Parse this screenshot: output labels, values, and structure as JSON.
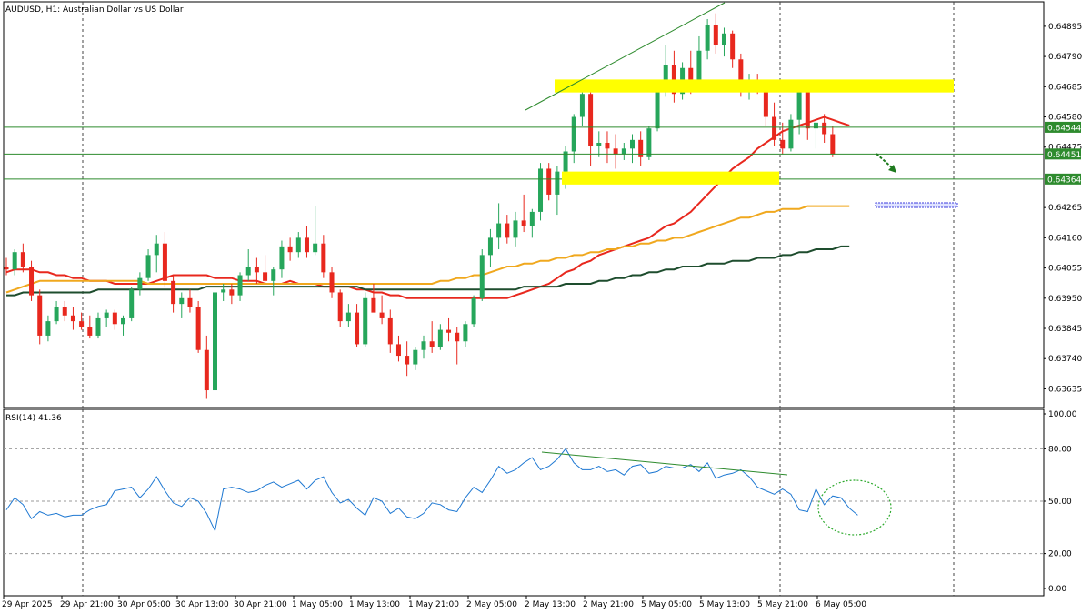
{
  "chart_data": {
    "type": "candlestick",
    "symbol": "AUDUSD",
    "timeframe": "H1",
    "title": "AUDUSD, H1:  Australian Dollar vs US Dollar",
    "price_axis_ticks": [
      "0.64895",
      "0.64790",
      "0.64685",
      "0.64580",
      "0.64475",
      "0.64265",
      "0.64160",
      "0.64055",
      "0.63950",
      "0.63845",
      "0.63740",
      "0.63635"
    ],
    "price_range": [
      0.6357,
      0.6498
    ],
    "time_labels": [
      "29 Apr 2025",
      "29 Apr 21:00",
      "30 Apr 05:00",
      "30 Apr 13:00",
      "30 Apr 21:00",
      "1 May 05:00",
      "1 May 13:00",
      "1 May 21:00",
      "2 May 05:00",
      "2 May 13:00",
      "2 May 21:00",
      "5 May 05:00",
      "5 May 13:00",
      "5 May 21:00",
      "6 May 05:00"
    ],
    "horizontal_levels": [
      {
        "value": 0.64544,
        "label": "0.64544",
        "color": "#2e8b2e"
      },
      {
        "value": 0.64451,
        "label": "0.64451",
        "color": "#2e8b2e"
      },
      {
        "value": 0.64364,
        "label": "0.64364",
        "color": "#2e8b2e"
      }
    ],
    "moving_averages": [
      {
        "color": "#e8281e",
        "values_from_hour": 0,
        "values": [
          0.6404,
          0.6405,
          0.6405,
          0.6405,
          0.6404,
          0.6404,
          0.6403,
          0.6403,
          0.6402,
          0.6402,
          0.6401,
          0.6401,
          0.6401,
          0.64,
          0.64,
          0.64,
          0.64,
          0.64,
          0.6401,
          0.6402,
          0.6403,
          0.6403,
          0.6403,
          0.6403,
          0.6403,
          0.6402,
          0.6402,
          0.6402,
          0.6401,
          0.6401,
          0.6401,
          0.64,
          0.64,
          0.64,
          0.6401,
          0.64,
          0.64,
          0.64,
          0.6399,
          0.6399,
          0.6399,
          0.6399,
          0.6398,
          0.6398,
          0.6397,
          0.6397,
          0.6396,
          0.6396,
          0.6395,
          0.6395,
          0.6395,
          0.6395,
          0.6395,
          0.6395,
          0.6395,
          0.6395,
          0.6395,
          0.6395,
          0.6395,
          0.6395,
          0.6395,
          0.6396,
          0.6397,
          0.6398,
          0.6399,
          0.64,
          0.6402,
          0.6404,
          0.6405,
          0.6407,
          0.6408,
          0.641,
          0.6411,
          0.6412,
          0.6413,
          0.6414,
          0.6415,
          0.6416,
          0.6418,
          0.642,
          0.6421,
          0.6423,
          0.6425,
          0.6428,
          0.6431,
          0.6434,
          0.6437,
          0.644,
          0.6442,
          0.6444,
          0.6447,
          0.6449,
          0.6451,
          0.6453,
          0.6454,
          0.6455,
          0.6456,
          0.6457,
          0.6458,
          0.6457,
          0.6456,
          0.6455
        ]
      },
      {
        "color": "#f0a81e",
        "values_from_hour": 0,
        "values": [
          0.6397,
          0.6398,
          0.6399,
          0.64,
          0.6401,
          0.6401,
          0.6401,
          0.6401,
          0.6401,
          0.6401,
          0.6401,
          0.6401,
          0.6401,
          0.6401,
          0.6401,
          0.6401,
          0.6401,
          0.64,
          0.64,
          0.64,
          0.64,
          0.64,
          0.64,
          0.64,
          0.64,
          0.64,
          0.64,
          0.64,
          0.64,
          0.64,
          0.64,
          0.64,
          0.64,
          0.64,
          0.64,
          0.64,
          0.64,
          0.64,
          0.64,
          0.64,
          0.64,
          0.64,
          0.64,
          0.64,
          0.64,
          0.64,
          0.64,
          0.64,
          0.64,
          0.64,
          0.64,
          0.64,
          0.6401,
          0.6401,
          0.6402,
          0.6402,
          0.6403,
          0.6403,
          0.6404,
          0.6405,
          0.6406,
          0.6406,
          0.6407,
          0.6407,
          0.6408,
          0.6408,
          0.6409,
          0.6409,
          0.641,
          0.641,
          0.6411,
          0.6411,
          0.6412,
          0.6412,
          0.6413,
          0.6413,
          0.6414,
          0.6414,
          0.6415,
          0.6415,
          0.6416,
          0.6416,
          0.6417,
          0.6418,
          0.6419,
          0.642,
          0.6421,
          0.6422,
          0.6423,
          0.6423,
          0.6424,
          0.6425,
          0.6425,
          0.6426,
          0.6426,
          0.6426,
          0.6427,
          0.6427,
          0.6427,
          0.6427,
          0.6427,
          0.6427
        ]
      },
      {
        "color": "#1e4d2e",
        "values_from_hour": 0,
        "values": [
          0.6396,
          0.6396,
          0.6397,
          0.6397,
          0.6397,
          0.6397,
          0.6397,
          0.6397,
          0.6397,
          0.6397,
          0.6397,
          0.6398,
          0.6398,
          0.6398,
          0.6398,
          0.6398,
          0.6398,
          0.6398,
          0.6398,
          0.6398,
          0.6398,
          0.6398,
          0.6398,
          0.6398,
          0.6399,
          0.6399,
          0.6399,
          0.6399,
          0.6399,
          0.6399,
          0.6399,
          0.6399,
          0.6399,
          0.6399,
          0.6399,
          0.6399,
          0.6399,
          0.6399,
          0.6399,
          0.6399,
          0.6399,
          0.6399,
          0.6399,
          0.6398,
          0.6398,
          0.6398,
          0.6398,
          0.6398,
          0.6398,
          0.6398,
          0.6398,
          0.6398,
          0.6398,
          0.6398,
          0.6398,
          0.6398,
          0.6398,
          0.6398,
          0.6398,
          0.6398,
          0.6398,
          0.6398,
          0.6399,
          0.6399,
          0.6399,
          0.6399,
          0.6399,
          0.64,
          0.64,
          0.64,
          0.64,
          0.6401,
          0.6401,
          0.6402,
          0.6402,
          0.6403,
          0.6403,
          0.6404,
          0.6404,
          0.6405,
          0.6405,
          0.6406,
          0.6406,
          0.6406,
          0.6407,
          0.6407,
          0.6407,
          0.6408,
          0.6408,
          0.6408,
          0.6409,
          0.6409,
          0.6409,
          0.641,
          0.641,
          0.6411,
          0.6411,
          0.6412,
          0.6412,
          0.6412,
          0.6413,
          0.6413
        ]
      }
    ],
    "candles": [
      [
        0.6406,
        0.6409,
        0.6403,
        0.6405
      ],
      [
        0.6405,
        0.6412,
        0.6403,
        0.6411
      ],
      [
        0.6411,
        0.6414,
        0.6404,
        0.6406
      ],
      [
        0.6406,
        0.6408,
        0.6394,
        0.6396
      ],
      [
        0.6396,
        0.6398,
        0.6379,
        0.6382
      ],
      [
        0.6382,
        0.6389,
        0.638,
        0.6387
      ],
      [
        0.6387,
        0.6394,
        0.6386,
        0.6392
      ],
      [
        0.6392,
        0.6394,
        0.6387,
        0.6389
      ],
      [
        0.6389,
        0.6392,
        0.6384,
        0.6387
      ],
      [
        0.6387,
        0.639,
        0.6384,
        0.6385
      ],
      [
        0.6385,
        0.6389,
        0.6381,
        0.6382
      ],
      [
        0.6382,
        0.639,
        0.6381,
        0.6388
      ],
      [
        0.6388,
        0.6391,
        0.6385,
        0.639
      ],
      [
        0.639,
        0.6391,
        0.6384,
        0.6386
      ],
      [
        0.6386,
        0.6389,
        0.6382,
        0.6388
      ],
      [
        0.6388,
        0.6399,
        0.6387,
        0.6398
      ],
      [
        0.6398,
        0.6404,
        0.6396,
        0.6402
      ],
      [
        0.6402,
        0.6412,
        0.6401,
        0.641
      ],
      [
        0.641,
        0.6417,
        0.6404,
        0.6414
      ],
      [
        0.6414,
        0.6418,
        0.6399,
        0.6401
      ],
      [
        0.6401,
        0.6403,
        0.639,
        0.6393
      ],
      [
        0.6393,
        0.6397,
        0.6388,
        0.6395
      ],
      [
        0.6395,
        0.6398,
        0.639,
        0.6392
      ],
      [
        0.6392,
        0.6394,
        0.6376,
        0.6377
      ],
      [
        0.6377,
        0.6382,
        0.636,
        0.6363
      ],
      [
        0.6363,
        0.6399,
        0.6361,
        0.6397
      ],
      [
        0.6397,
        0.64,
        0.6394,
        0.6398
      ],
      [
        0.6398,
        0.64,
        0.6393,
        0.6396
      ],
      [
        0.6396,
        0.6404,
        0.6394,
        0.6403
      ],
      [
        0.6403,
        0.6412,
        0.6401,
        0.6406
      ],
      [
        0.6406,
        0.6409,
        0.64,
        0.6404
      ],
      [
        0.6404,
        0.641,
        0.64,
        0.6401
      ],
      [
        0.6401,
        0.6406,
        0.6396,
        0.6405
      ],
      [
        0.6405,
        0.6415,
        0.6402,
        0.6413
      ],
      [
        0.6413,
        0.6416,
        0.6408,
        0.6411
      ],
      [
        0.6411,
        0.6418,
        0.6409,
        0.6416
      ],
      [
        0.6416,
        0.642,
        0.6409,
        0.6411
      ],
      [
        0.6411,
        0.6427,
        0.641,
        0.6414
      ],
      [
        0.6414,
        0.6417,
        0.6402,
        0.6404
      ],
      [
        0.6404,
        0.6406,
        0.6395,
        0.6397
      ],
      [
        0.6397,
        0.6398,
        0.6385,
        0.6387
      ],
      [
        0.6387,
        0.6393,
        0.6385,
        0.639
      ],
      [
        0.639,
        0.6393,
        0.6378,
        0.6379
      ],
      [
        0.6379,
        0.6397,
        0.6378,
        0.6395
      ],
      [
        0.6395,
        0.64,
        0.6392,
        0.639
      ],
      [
        0.639,
        0.6396,
        0.6386,
        0.6388
      ],
      [
        0.6388,
        0.6391,
        0.6376,
        0.6379
      ],
      [
        0.6379,
        0.6382,
        0.6373,
        0.6375
      ],
      [
        0.6375,
        0.638,
        0.6368,
        0.6372
      ],
      [
        0.6372,
        0.6378,
        0.637,
        0.6377
      ],
      [
        0.6377,
        0.6382,
        0.6374,
        0.638
      ],
      [
        0.638,
        0.6387,
        0.6376,
        0.6378
      ],
      [
        0.6378,
        0.6386,
        0.6377,
        0.6384
      ],
      [
        0.6384,
        0.6388,
        0.638,
        0.6383
      ],
      [
        0.6383,
        0.6385,
        0.6372,
        0.638
      ],
      [
        0.638,
        0.6387,
        0.6378,
        0.6386
      ],
      [
        0.6386,
        0.6396,
        0.6385,
        0.6395
      ],
      [
        0.6395,
        0.6412,
        0.6394,
        0.641
      ],
      [
        0.641,
        0.6419,
        0.6406,
        0.6416
      ],
      [
        0.6416,
        0.6428,
        0.6412,
        0.6421
      ],
      [
        0.6421,
        0.6424,
        0.6414,
        0.6416
      ],
      [
        0.6416,
        0.6425,
        0.6413,
        0.6422
      ],
      [
        0.6422,
        0.6431,
        0.6418,
        0.642
      ],
      [
        0.642,
        0.6426,
        0.6416,
        0.6425
      ],
      [
        0.6425,
        0.6442,
        0.6422,
        0.644
      ],
      [
        0.644,
        0.6442,
        0.6429,
        0.6431
      ],
      [
        0.6431,
        0.6441,
        0.6424,
        0.6439
      ],
      [
        0.6439,
        0.6448,
        0.6433,
        0.6446
      ],
      [
        0.6446,
        0.6459,
        0.6442,
        0.6458
      ],
      [
        0.6458,
        0.647,
        0.6455,
        0.6466
      ],
      [
        0.6466,
        0.6469,
        0.6441,
        0.6448
      ],
      [
        0.6448,
        0.6453,
        0.6444,
        0.6449
      ],
      [
        0.6449,
        0.6453,
        0.6442,
        0.6447
      ],
      [
        0.6447,
        0.6452,
        0.644,
        0.6445
      ],
      [
        0.6445,
        0.6449,
        0.6443,
        0.6447
      ],
      [
        0.6447,
        0.6452,
        0.6442,
        0.645
      ],
      [
        0.645,
        0.6453,
        0.6441,
        0.6444
      ],
      [
        0.6444,
        0.6455,
        0.6443,
        0.6454
      ],
      [
        0.6454,
        0.647,
        0.6453,
        0.6468
      ],
      [
        0.6468,
        0.6483,
        0.6465,
        0.6476
      ],
      [
        0.6476,
        0.6481,
        0.6463,
        0.6466
      ],
      [
        0.6466,
        0.6477,
        0.6464,
        0.6475
      ],
      [
        0.6475,
        0.6481,
        0.6466,
        0.6468
      ],
      [
        0.6468,
        0.6486,
        0.6467,
        0.6481
      ],
      [
        0.6481,
        0.6492,
        0.6478,
        0.649
      ],
      [
        0.649,
        0.6494,
        0.648,
        0.6483
      ],
      [
        0.6483,
        0.6489,
        0.6479,
        0.6487
      ],
      [
        0.6487,
        0.6488,
        0.6475,
        0.6478
      ],
      [
        0.6478,
        0.648,
        0.6465,
        0.6468
      ],
      [
        0.6468,
        0.6473,
        0.6464,
        0.647
      ],
      [
        0.647,
        0.6473,
        0.6466,
        0.6469
      ],
      [
        0.6469,
        0.647,
        0.6455,
        0.6458
      ],
      [
        0.6458,
        0.6463,
        0.6448,
        0.645
      ],
      [
        0.645,
        0.6456,
        0.6445,
        0.6447
      ],
      [
        0.6447,
        0.6459,
        0.6446,
        0.6457
      ],
      [
        0.6457,
        0.647,
        0.6452,
        0.6468
      ],
      [
        0.6468,
        0.647,
        0.645,
        0.6454
      ],
      [
        0.6454,
        0.6458,
        0.6447,
        0.6456
      ],
      [
        0.6456,
        0.6459,
        0.6449,
        0.6452
      ],
      [
        0.6452,
        0.6455,
        0.6444,
        0.6445
      ]
    ],
    "rsi": {
      "label": "RSI(14) 41.36",
      "period": 14,
      "value": 41.36,
      "range": [
        0,
        100
      ],
      "levels": [
        80,
        50,
        20
      ],
      "ticks": [
        "100.00",
        "80.00",
        "50.00",
        "20.00",
        "0.00"
      ],
      "values": [
        45,
        52,
        48,
        40,
        44,
        42,
        43,
        41,
        42,
        42,
        45,
        47,
        48,
        56,
        57,
        58,
        52,
        57,
        64,
        56,
        49,
        47,
        52,
        50,
        43,
        33,
        57,
        58,
        57,
        55,
        56,
        59,
        61,
        58,
        60,
        62,
        57,
        62,
        64,
        55,
        49,
        51,
        46,
        42,
        52,
        50,
        43,
        46,
        41,
        40,
        43,
        49,
        48,
        45,
        44,
        52,
        58,
        55,
        62,
        70,
        66,
        68,
        72,
        75,
        68,
        70,
        74,
        80,
        72,
        68,
        68,
        70,
        67,
        68,
        65,
        70,
        71,
        66,
        67,
        70,
        69,
        69,
        71,
        67,
        72,
        63,
        65,
        66,
        68,
        64,
        58,
        56,
        54,
        57,
        54,
        45,
        44,
        57,
        48,
        53,
        52,
        46,
        42
      ]
    },
    "annotations": {
      "support_zones": [
        {
          "low": 0.64665,
          "high": 0.6471,
          "color": "#ffff00"
        },
        {
          "low": 0.64345,
          "high": 0.6439,
          "color": "#ffff00"
        }
      ],
      "target_level": {
        "value": 0.64275,
        "color": "#3c3cdc"
      },
      "trendline_color": "#2e8b2e",
      "arrow_color": "#1e7a1e",
      "circle_color": "#2eaa2e"
    },
    "grid": true,
    "colors": {
      "bull": "#26a65b",
      "bear": "#e8281e",
      "price_label_bg": "#2e8b2e"
    }
  }
}
